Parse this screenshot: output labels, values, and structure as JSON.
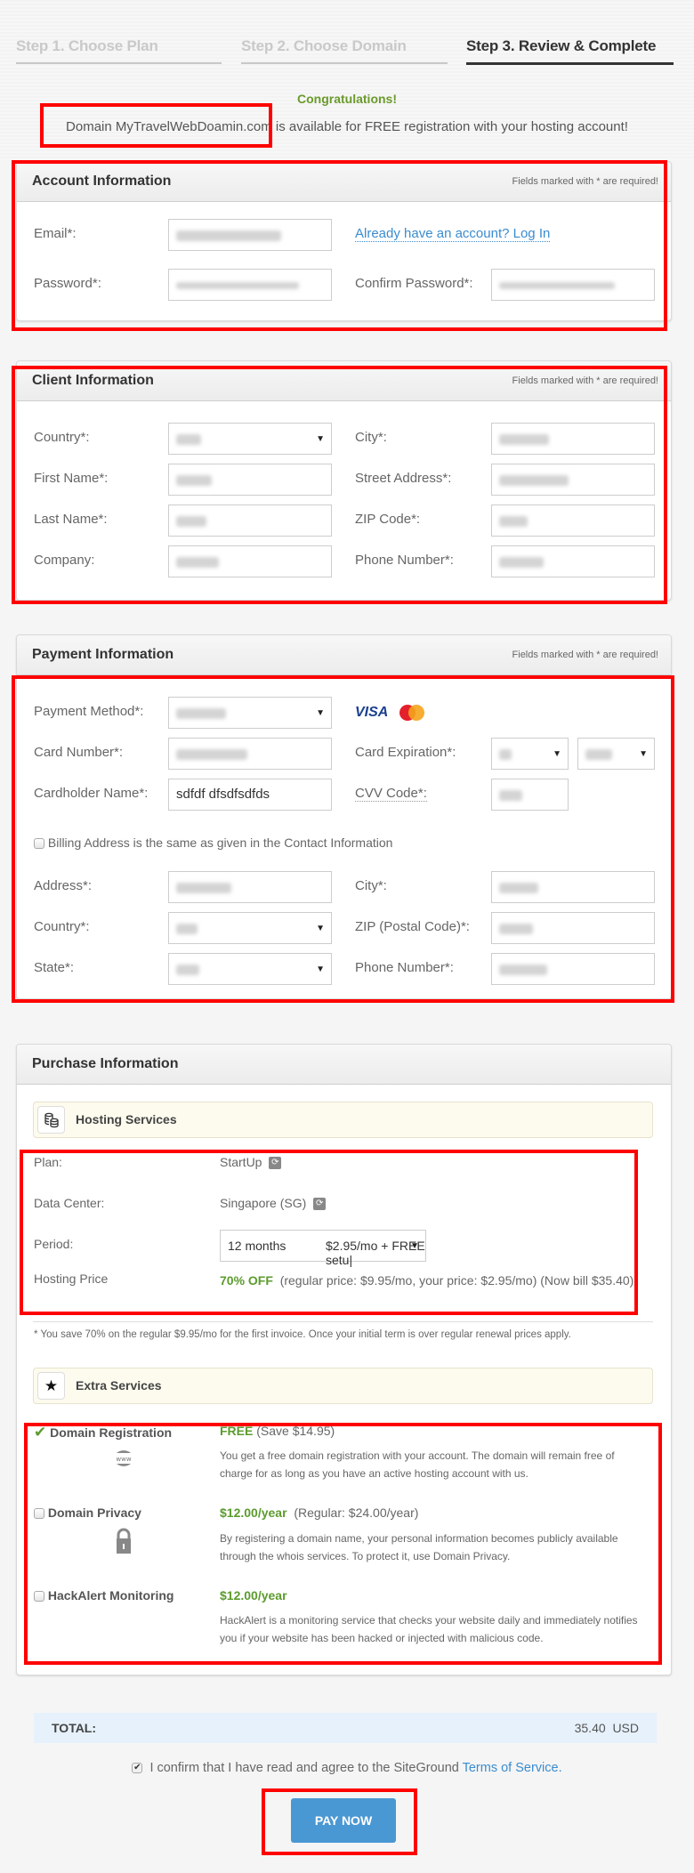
{
  "steps": [
    {
      "label": "Step 1. Choose Plan",
      "state": "inactive"
    },
    {
      "label": "Step 2. Choose Domain",
      "state": "inactive"
    },
    {
      "label": "Step 3. Review & Complete",
      "state": "active"
    }
  ],
  "banner": {
    "title": "Congratulations!",
    "message": "Domain MyTravelWebDoamin.com is available for FREE registration with your hosting account!"
  },
  "required_note": "Fields marked with * are required!",
  "account": {
    "title": "Account Information",
    "email_label": "Email*:",
    "email_value": "[obscured]",
    "login_link": "Already have an account? Log In",
    "password_label": "Password*:",
    "password_value": "[obscured]",
    "confirm_label": "Confirm Password*:",
    "confirm_value": "[obscured]"
  },
  "client": {
    "title": "Client Information",
    "fields": [
      {
        "label": "Country*:",
        "value": "[obscured]",
        "type": "select"
      },
      {
        "label": "City*:",
        "value": "[obscured]",
        "type": "text"
      },
      {
        "label": "First Name*:",
        "value": "[obscured]",
        "type": "text"
      },
      {
        "label": "Street Address*:",
        "value": "[obscured]",
        "type": "text"
      },
      {
        "label": "Last Name*:",
        "value": "[obscured]",
        "type": "text"
      },
      {
        "label": "ZIP Code*:",
        "value": "[obscured]",
        "type": "text"
      },
      {
        "label": "Company:",
        "value": "[obscured]",
        "type": "text"
      },
      {
        "label": "Phone Number*:",
        "value": "[obscured]",
        "type": "text"
      }
    ]
  },
  "payment": {
    "title": "Payment Information",
    "method_label": "Payment Method*:",
    "method_value": "[obscured]",
    "card_brands": [
      "VISA",
      "MasterCard"
    ],
    "card_number_label": "Card Number*:",
    "card_number_value": "[obscured]",
    "expiration_label": "Card Expiration*:",
    "exp_month_value": "[obscured]",
    "exp_year_value": "[obscured]",
    "holder_label": "Cardholder Name*:",
    "holder_value": "sdfdf dfsdfsdfds",
    "cvv_label": "CVV Code*:",
    "cvv_value": "[obscured]",
    "billing_same_label": "Billing Address is the same as given in the Contact Information",
    "billing_same_checked": false,
    "billing_fields": [
      {
        "label": "Address*:",
        "value": "[obscured]",
        "type": "text"
      },
      {
        "label": "City*:",
        "value": "[obscured]",
        "type": "text"
      },
      {
        "label": "Country*:",
        "value": "[obscured]",
        "type": "select"
      },
      {
        "label": "ZIP (Postal Code)*:",
        "value": "[obscured]",
        "type": "text"
      },
      {
        "label": "State*:",
        "value": "[obscured]",
        "type": "select"
      },
      {
        "label": "Phone Number*:",
        "value": "[obscured]",
        "type": "text"
      }
    ]
  },
  "purchase": {
    "title": "Purchase Information",
    "hosting_title": "Hosting Services",
    "plan_label": "Plan:",
    "plan_value": "StartUp",
    "dc_label": "Data Center:",
    "dc_value": "Singapore (SG)",
    "period_label": "Period:",
    "period_value": "12 months",
    "period_price": "$2.95/mo + FREE setu|",
    "price_label": "Hosting Price",
    "price_off": "70% OFF",
    "price_detail": "(regular price: $9.95/mo, your price: $2.95/mo) (Now bill $35.40)",
    "savings_note": "* You save 70% on the regular $9.95/mo for the first invoice. Once your initial term is over regular renewal prices apply.",
    "extras_title": "Extra Services",
    "extras": [
      {
        "name": "Domain Registration",
        "checked": true,
        "price": "FREE",
        "price_note": "(Save $14.95)",
        "icon": "www-globe-icon",
        "icon_text": "www",
        "desc": "You get a free domain registration with your account. The domain will remain free of charge for as long as you have an active hosting account with us."
      },
      {
        "name": "Domain Privacy",
        "checked": false,
        "price": "$12.00/year",
        "price_note": "(Regular: $24.00/year)",
        "icon": "padlock-icon",
        "desc": "By registering a domain name, your personal information becomes publicly available through the whois services. To protect it, use Domain Privacy."
      },
      {
        "name": "HackAlert Monitoring",
        "checked": false,
        "price": "$12.00/year",
        "price_note": "",
        "icon": "",
        "desc": "HackAlert is a monitoring service that checks your website daily and immediately notifies you if your website has been hacked or injected with malicious code."
      }
    ]
  },
  "total": {
    "label": "TOTAL:",
    "amount": "35.40",
    "currency": "USD"
  },
  "terms": {
    "checked": true,
    "text": "I confirm that I have read and agree to the SiteGround ",
    "link": "Terms of Service."
  },
  "pay_button": "PAY NOW",
  "colors": {
    "accent_green": "#5c9b2e",
    "link_blue": "#3a8ccf",
    "button_blue": "#4a98d3",
    "highlight_red": "#ff0000",
    "total_bg": "#e6f1fb"
  }
}
